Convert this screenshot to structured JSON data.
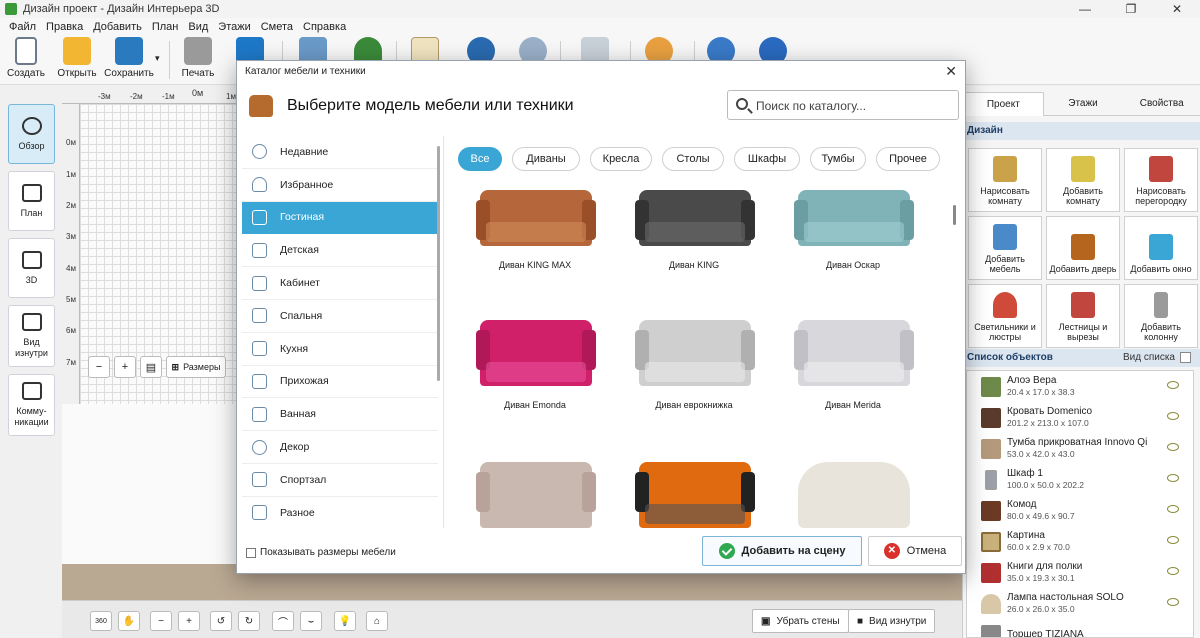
{
  "window": {
    "title": "Дизайн проект - Дизайн Интерьера 3D"
  },
  "menu": [
    "Файл",
    "Правка",
    "Добавить",
    "План",
    "Вид",
    "Этажи",
    "Смета",
    "Справка"
  ],
  "toolbar": {
    "create": "Создать",
    "open": "Открыть",
    "save": "Сохранить",
    "print": "Печать",
    "partial": "П"
  },
  "leftnav": [
    {
      "label": "Обзор"
    },
    {
      "label": "План"
    },
    {
      "label": "3D"
    },
    {
      "label": "Вид изнутри"
    },
    {
      "label": "Комму-никации"
    }
  ],
  "ruler": {
    "h": [
      "-3м",
      "-2м",
      "-1м",
      "0м",
      "1м"
    ],
    "v": [
      "0м",
      "1м",
      "2м",
      "3м",
      "4м",
      "5м",
      "6м",
      "7м"
    ]
  },
  "plan_tools": {
    "dims": "Размеры"
  },
  "bottom": {
    "remove_walls": "Убрать стены",
    "inside_view": "Вид изнутри",
    "icon360": "360"
  },
  "right": {
    "tabs": [
      "Проект",
      "Этажи",
      "Свойства"
    ],
    "design_header": "Дизайн",
    "design": [
      {
        "label": "Нарисовать комнату",
        "color": "#c9a24a"
      },
      {
        "label": "Добавить комнату",
        "color": "#d8c24a"
      },
      {
        "label": "Нарисовать перегородку",
        "color": "#c0463e"
      },
      {
        "label": "Добавить мебель",
        "color": "#4a8ac8"
      },
      {
        "label": "Добавить дверь",
        "color": "#b5651d"
      },
      {
        "label": "Добавить окно",
        "color": "#3aa6d6"
      },
      {
        "label": "Светильники и люстры",
        "color": "#d04a3a"
      },
      {
        "label": "Лестницы и вырезы",
        "color": "#c0463e"
      },
      {
        "label": "Добавить колонну",
        "color": "#9a9a9a"
      }
    ],
    "objects_header": "Список объектов",
    "objects_view": "Вид списка",
    "objects": [
      {
        "name": "Алоэ Вера",
        "dims": "20.4 x 17.0 x 38.3",
        "color": "#6e8a4a"
      },
      {
        "name": "Кровать Domenico",
        "dims": "201.2 x 213.0 x 107.0",
        "color": "#5a3a2a"
      },
      {
        "name": "Тумба прикроватная Innovo Qi",
        "dims": "53.0 x 42.0 x 43.0",
        "color": "#b49a7a"
      },
      {
        "name": "Шкаф 1",
        "dims": "100.0 x 50.0 x 202.2",
        "color": "#9aa0a6"
      },
      {
        "name": "Комод",
        "dims": "80.0 x 49.6 x 90.7",
        "color": "#6a3a24"
      },
      {
        "name": "Картина",
        "dims": "60.0 x 2.9 x 70.0",
        "color": "#c9b27a"
      },
      {
        "name": "Книги для полки",
        "dims": "35.0 x 19.3 x 30.1",
        "color": "#b03030"
      },
      {
        "name": "Лампа настольная SOLO",
        "dims": "26.0 x 26.0 x 35.0",
        "color": "#d8c8a8"
      },
      {
        "name": "Торшер TIZIANA",
        "dims": "",
        "color": "#888888"
      }
    ]
  },
  "modal": {
    "window_title": "Каталог мебели и техники",
    "heading": "Выберите модель мебели или техники",
    "search_placeholder": "Поиск по каталогу...",
    "categories": [
      "Недавние",
      "Избранное",
      "Гостиная",
      "Детская",
      "Кабинет",
      "Спальня",
      "Кухня",
      "Прихожая",
      "Ванная",
      "Декор",
      "Спортзал",
      "Разное"
    ],
    "active_category": "Гостиная",
    "filters": [
      "Все",
      "Диваны",
      "Кресла",
      "Столы",
      "Шкафы",
      "Тумбы",
      "Прочее"
    ],
    "active_filter": "Все",
    "items": [
      {
        "name": "Диван KING MAX",
        "color": "#b5663a"
      },
      {
        "name": "Диван KING",
        "color": "#4a4a4a"
      },
      {
        "name": "Диван Оскар",
        "color": "#7fb3b8"
      },
      {
        "name": "Диван Emonda",
        "color": "#d0206a"
      },
      {
        "name": "Диван еврокнижка",
        "color": "#cfcfcf"
      },
      {
        "name": "Диван Merida",
        "color": "#d8d8dc"
      },
      {
        "name": "",
        "color": "#c9b8b0"
      },
      {
        "name": "",
        "color": "#e06a10"
      },
      {
        "name": "",
        "color": "#e8e4dc"
      }
    ],
    "show_dims": "Показывать размеры мебели",
    "add": "Добавить на сцену",
    "cancel": "Отмена"
  }
}
